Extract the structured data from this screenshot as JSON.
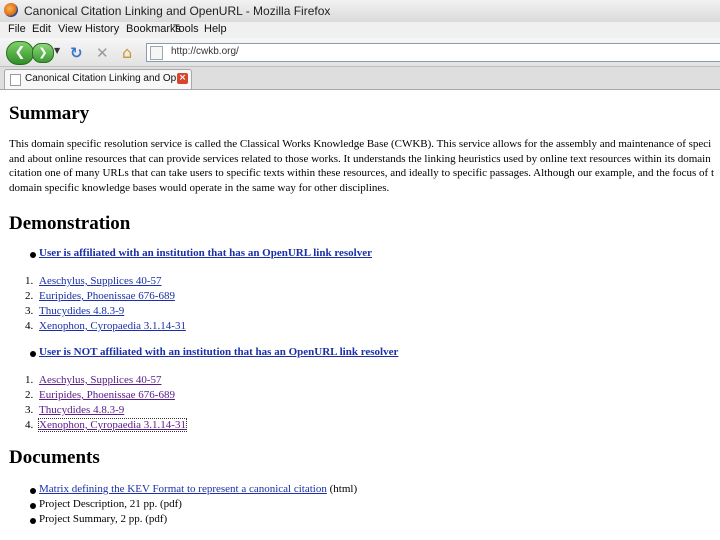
{
  "window": {
    "title": "Canonical Citation Linking and OpenURL - Mozilla Firefox"
  },
  "menu": [
    "File",
    "Edit",
    "View",
    "History",
    "Bookmarks",
    "Tools",
    "Help"
  ],
  "nav": {
    "url": "http://cwkb.org/"
  },
  "tab": {
    "label": "Canonical Citation Linking and Op..."
  },
  "page": {
    "summary_heading": "Summary",
    "summary_lines": [
      "This domain specific resolution service is called the Classical Works Knowledge Base (CWKB). This service allows for the assembly and maintenance of speci",
      "and about online resources that can provide services related to those works. It understands the linking heuristics used by online text resources within its domain",
      "citation one of many URLs that can take users to specific texts within these resources, and ideally to specific passages. Although our example, and the focus of t",
      "domain specific knowledge bases would operate in the same way for other disciplines."
    ],
    "demo_heading": "Demonstration",
    "affiliated_link": "User is affiliated with an institution that has an OpenURL link resolver",
    "affiliated_items": [
      "Aeschylus, Supplices 40-57",
      "Euripides, Phoenissae 676-689",
      "Thucydides 4.8.3-9",
      "Xenophon, Cyropaedia 3.1.14-31"
    ],
    "not_affiliated_link": "User is NOT affiliated with an institution that has an OpenURL link resolver",
    "not_affiliated_items": [
      "Aeschylus, Supplices 40-57",
      "Euripides, Phoenissae 676-689",
      "Thucydides 4.8.3-9",
      "Xenophon, Cyropaedia 3.1.14-31"
    ],
    "docs_heading": "Documents",
    "doc1_link": "Matrix defining the KEV Format to represent a canonical citation",
    "doc1_suffix": " (html)",
    "doc2": "Project Description, 21 pp. (pdf)",
    "doc3": "Project Summary, 2 pp. (pdf)"
  }
}
